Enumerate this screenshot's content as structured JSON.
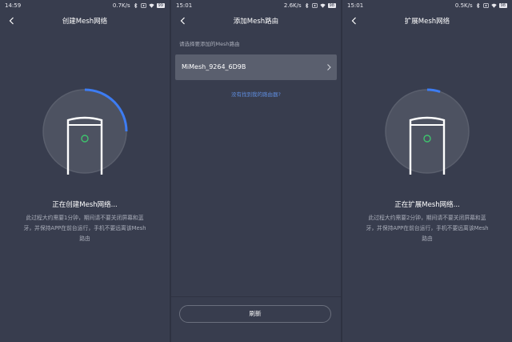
{
  "screens": [
    {
      "status": {
        "time": "14:59",
        "speed": "0.7K/s",
        "battery": "99"
      },
      "title": "创建Mesh网络",
      "progress": 0.25,
      "status_message": "正在创建Mesh网络...",
      "description_lines": [
        "此过程大约需要1分钟，期间请不要关闭屏幕和蓝",
        "牙，并保持APP在前台运行，手机不要远离该Mesh",
        "路由"
      ]
    },
    {
      "status": {
        "time": "15:01",
        "speed": "2.6K/s",
        "battery": "98"
      },
      "title": "添加Mesh路由",
      "prompt": "请选择要添加的Mesh路由",
      "device_name": "MiMesh_9264_6D9B",
      "help_link": "没有找到我的路由器?",
      "refresh_label": "刷新"
    },
    {
      "status": {
        "time": "15:01",
        "speed": "0.5K/s",
        "battery": "98"
      },
      "title": "扩展Mesh网络",
      "progress": 0.05,
      "status_message": "正在扩展Mesh网络...",
      "description_lines": [
        "此过程大约需要2分钟，期间请不要关闭屏幕和蓝",
        "牙，并保持APP在前台运行，手机不要远离该Mesh",
        "路由"
      ]
    }
  ],
  "colors": {
    "background": "#383d4e",
    "accent": "#3d7cf2",
    "router_light": "#3ec46d",
    "link": "#5f8dde"
  },
  "icons": [
    "back-arrow-icon",
    "bluetooth-icon",
    "alarm-icon",
    "wifi-icon",
    "battery-icon",
    "chevron-right-icon",
    "router-icon"
  ]
}
